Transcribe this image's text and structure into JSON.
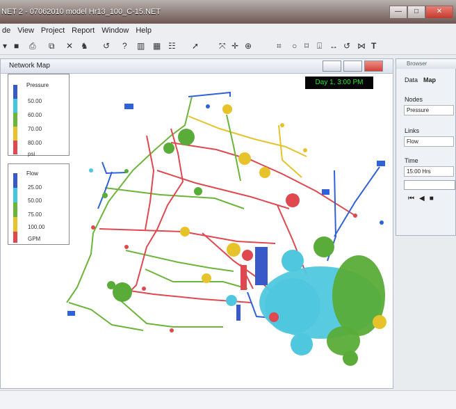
{
  "window": {
    "title": "NET 2 - 07062010 model Hr13_100_C-15.NET",
    "controls": [
      "—",
      "□",
      "✕"
    ]
  },
  "menu": [
    "de",
    "View",
    "Project",
    "Report",
    "Window",
    "Help"
  ],
  "toolbar": {
    "tools": [
      "▾",
      "■",
      "⎙",
      "⧉",
      "✕",
      "♞",
      "↺",
      "?",
      "▥",
      "▦",
      "☷",
      "➚",
      "⤧",
      "✛",
      "⊕",
      "⌗",
      "○",
      "⌑",
      "⍗",
      "↔",
      "↺",
      "⋈",
      "T"
    ]
  },
  "network_map": {
    "title": "Network Map",
    "time_label": "Day 1, 3:00 PM",
    "pressure_legend": {
      "title": "Pressure",
      "levels": [
        "50.00",
        "60.00",
        "70.00",
        "80.00"
      ],
      "unit": "psi",
      "colors": [
        "#3a59c9",
        "#43c6de",
        "#6cb43a",
        "#e6c22b",
        "#e0484f"
      ]
    },
    "flow_legend": {
      "title": "Flow",
      "levels": [
        "25.00",
        "50.00",
        "75.00",
        "100.00"
      ],
      "unit": "GPM",
      "colors": [
        "#3a59c9",
        "#43c6de",
        "#6cb43a",
        "#e6c22b",
        "#e0484f"
      ]
    }
  },
  "browser": {
    "title": "Browser",
    "tabs": [
      "Data",
      "Map"
    ],
    "nodes_label": "Nodes",
    "nodes_value": "Pressure",
    "links_label": "Links",
    "links_value": "Flow",
    "time_label": "Time",
    "time_value": "15:00 Hrs",
    "playback": [
      "⏮",
      "◀",
      "■"
    ]
  }
}
